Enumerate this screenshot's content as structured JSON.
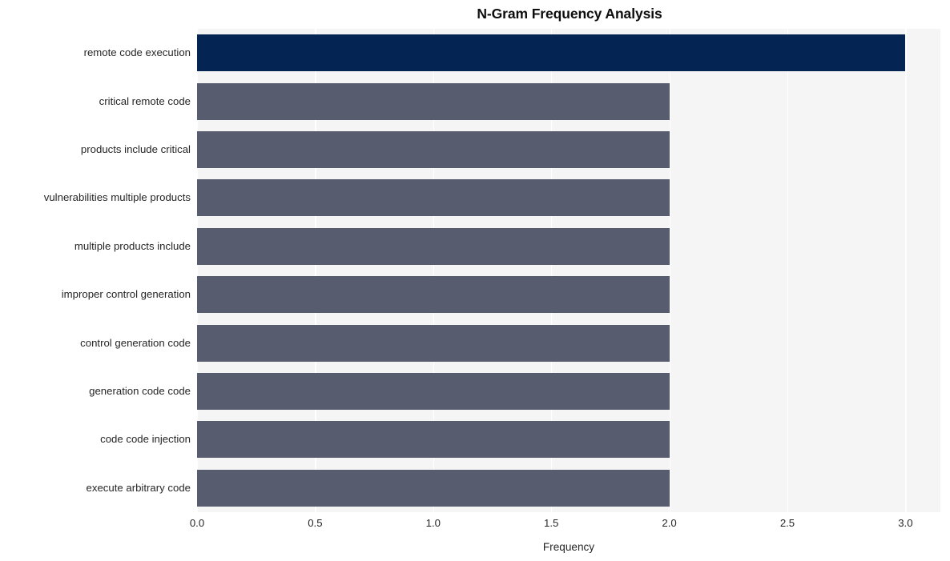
{
  "chart_data": {
    "type": "bar",
    "orientation": "horizontal",
    "title": "N-Gram Frequency Analysis",
    "xlabel": "Frequency",
    "ylabel": "",
    "categories": [
      "remote code execution",
      "critical remote code",
      "products include critical",
      "vulnerabilities multiple products",
      "multiple products include",
      "improper control generation",
      "control generation code",
      "generation code code",
      "code code injection",
      "execute arbitrary code"
    ],
    "values": [
      3,
      2,
      2,
      2,
      2,
      2,
      2,
      2,
      2,
      2
    ],
    "bar_colors": [
      "#042453",
      "#575c6e",
      "#575c6e",
      "#575c6e",
      "#575c6e",
      "#575c6e",
      "#575c6e",
      "#575c6e",
      "#575c6e",
      "#575c6e"
    ],
    "xlim": [
      0.0,
      3.1479
    ],
    "xticks": [
      0.0,
      0.5,
      1.0,
      1.5,
      2.0,
      2.5,
      3.0
    ],
    "xtick_labels": [
      "0.0",
      "0.5",
      "1.0",
      "1.5",
      "2.0",
      "2.5",
      "3.0"
    ],
    "grid": true,
    "grid_axis": "x",
    "grid_color": "#ffffff",
    "legend": false,
    "plot_background": "#f5f5f6",
    "figure_background": "#ffffff",
    "text_color": "#262626",
    "title_color": "#0d0d0d"
  }
}
